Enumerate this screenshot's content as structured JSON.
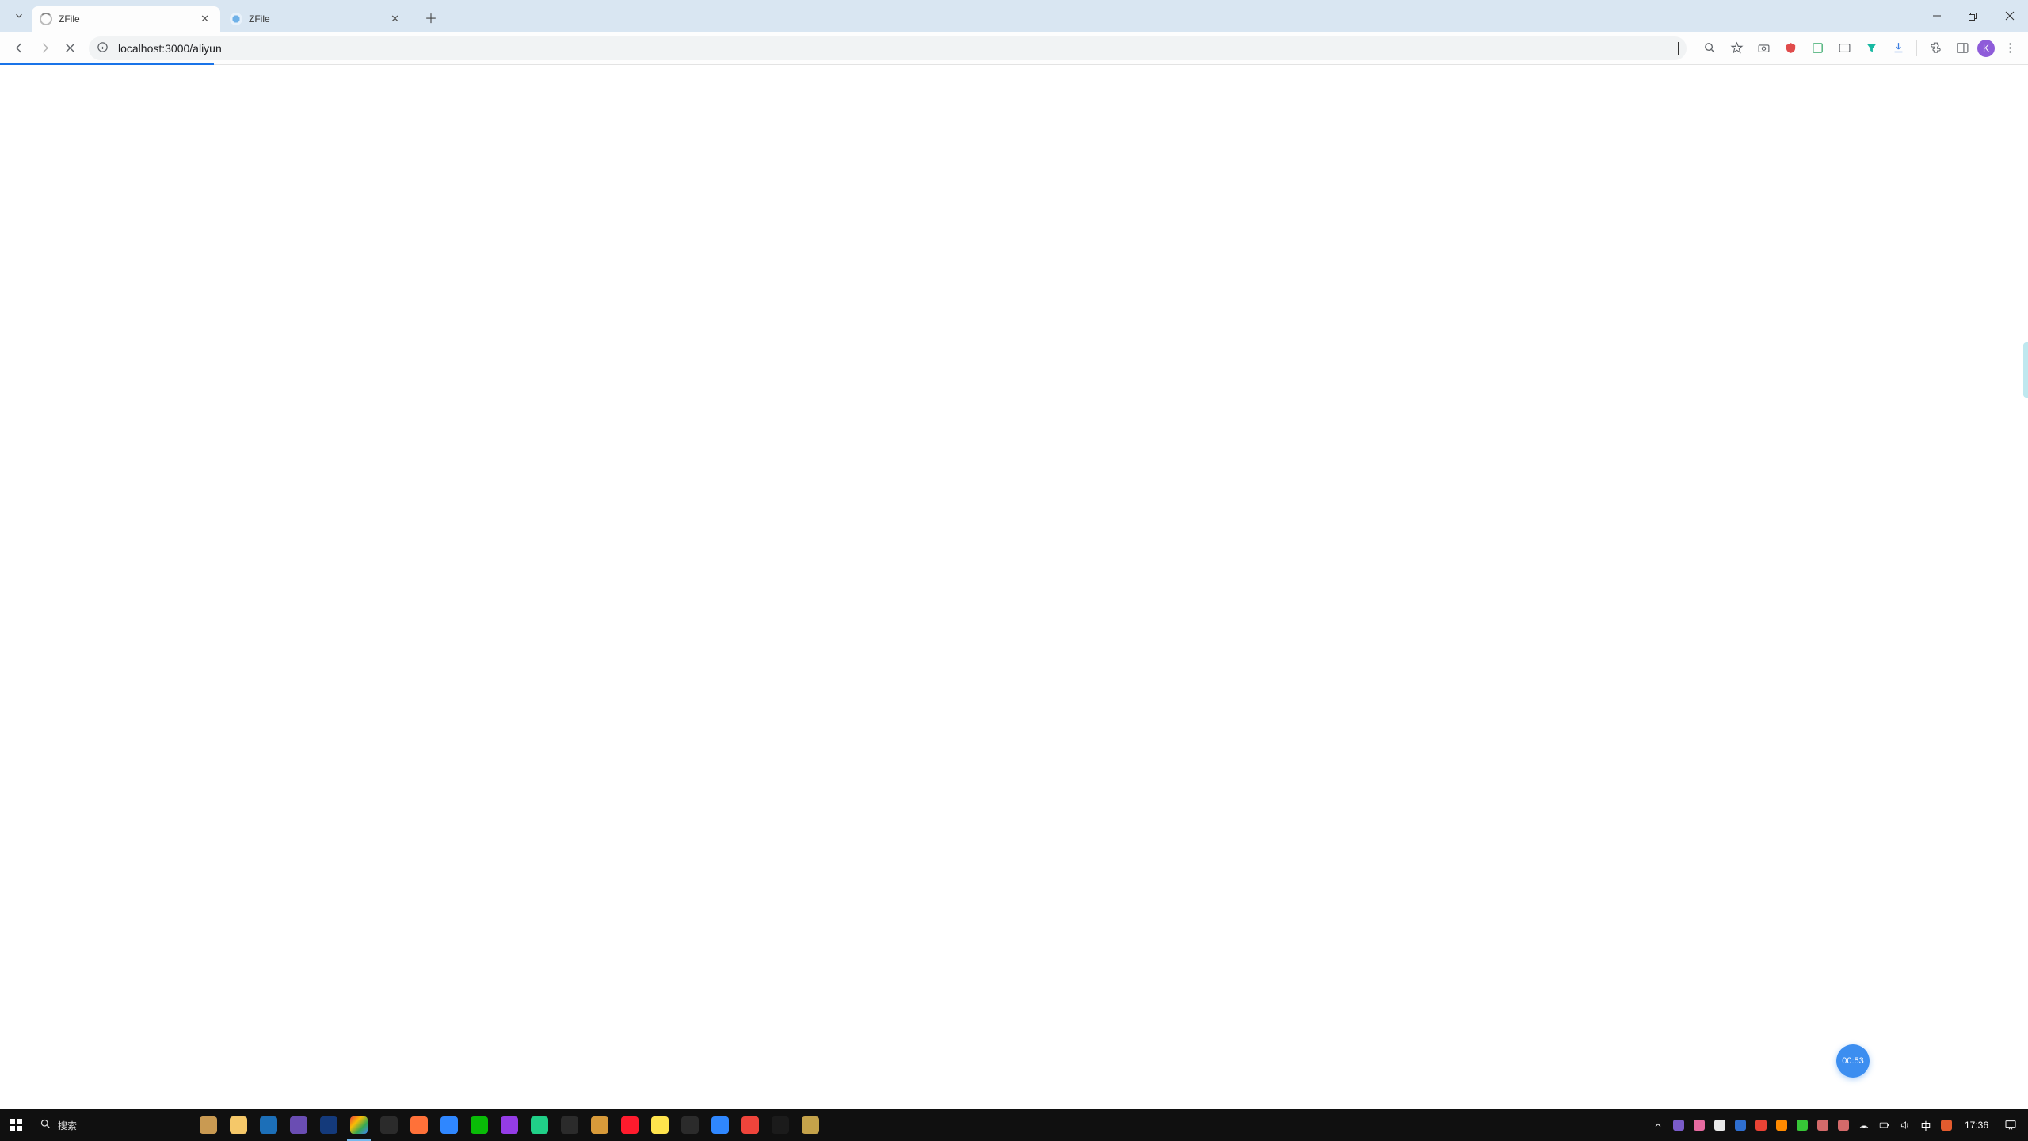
{
  "browser": {
    "tabs": [
      {
        "title": "ZFile",
        "active": true
      },
      {
        "title": "ZFile",
        "active": false
      }
    ],
    "url": "localhost:3000/aliyun",
    "loading": true
  },
  "toolbar_icons": [
    {
      "name": "zoom-icon"
    },
    {
      "name": "bookmark-star-icon"
    },
    {
      "name": "camera-icon"
    },
    {
      "name": "adblock-icon"
    },
    {
      "name": "screenshot-icon"
    },
    {
      "name": "translate-icon"
    },
    {
      "name": "filter-icon"
    },
    {
      "name": "downloads-icon"
    },
    {
      "name": "extensions-puzzle-icon"
    },
    {
      "name": "sidepanel-icon"
    }
  ],
  "avatar_letter": "K",
  "float_timer": "00:53",
  "taskbar": {
    "search_placeholder": "搜索",
    "clock": "17:36",
    "ime": "中",
    "apps": [
      {
        "name": "user-avatar-app",
        "bg": "#c99a52"
      },
      {
        "name": "file-explorer",
        "bg": "#f5c869"
      },
      {
        "name": "microsoft-store",
        "bg": "#1c6fb8"
      },
      {
        "name": "photos",
        "bg": "#6a4db3"
      },
      {
        "name": "paypal",
        "bg": "#143a7b"
      },
      {
        "name": "chrome",
        "bg": "linear-gradient(135deg,#ea4335,#fbbc05,#34a853,#4285f4)",
        "active": true
      },
      {
        "name": "extension-app",
        "bg": "#2b2b2b"
      },
      {
        "name": "firefox",
        "bg": "#ff7139"
      },
      {
        "name": "todesk",
        "bg": "#2f87ff"
      },
      {
        "name": "wechat",
        "bg": "#09bb07"
      },
      {
        "name": "qqmusic",
        "bg": "#943ce6"
      },
      {
        "name": "jetbrains",
        "bg": "#20d088"
      },
      {
        "name": "terminal",
        "bg": "#2b2b2b"
      },
      {
        "name": "discord",
        "bg": "#d79a3a"
      },
      {
        "name": "opera",
        "bg": "#ff1b2d"
      },
      {
        "name": "wps",
        "bg": "#ffe44d"
      },
      {
        "name": "obs",
        "bg": "#2b2b2b"
      },
      {
        "name": "vscode",
        "bg": "#2f87ff"
      },
      {
        "name": "anydesk",
        "bg": "#ef443b"
      },
      {
        "name": "music",
        "bg": "#1b1b1b"
      },
      {
        "name": "notes",
        "bg": "#c4a24a"
      }
    ],
    "tray": [
      {
        "name": "tray-chevron",
        "bg": "transparent"
      },
      {
        "name": "tray-purple",
        "bg": "#7a5cc9"
      },
      {
        "name": "tray-pink",
        "bg": "#e66aa0"
      },
      {
        "name": "tray-white",
        "bg": "#e9e9e9"
      },
      {
        "name": "tray-blue",
        "bg": "#2f6fd0"
      },
      {
        "name": "tray-red",
        "bg": "#ea4335"
      },
      {
        "name": "tray-orange",
        "bg": "#ff8a00"
      },
      {
        "name": "tray-green",
        "bg": "#37c637"
      },
      {
        "name": "tray-person",
        "bg": "#d46a6a"
      },
      {
        "name": "tray-person2",
        "bg": "#d46a6a"
      },
      {
        "name": "tray-network",
        "bg": "transparent"
      },
      {
        "name": "tray-battery",
        "bg": "transparent"
      },
      {
        "name": "tray-volume",
        "bg": "transparent"
      },
      {
        "name": "tray-ime",
        "bg": "transparent"
      },
      {
        "name": "tray-shield",
        "bg": "#e35b2e"
      }
    ]
  }
}
